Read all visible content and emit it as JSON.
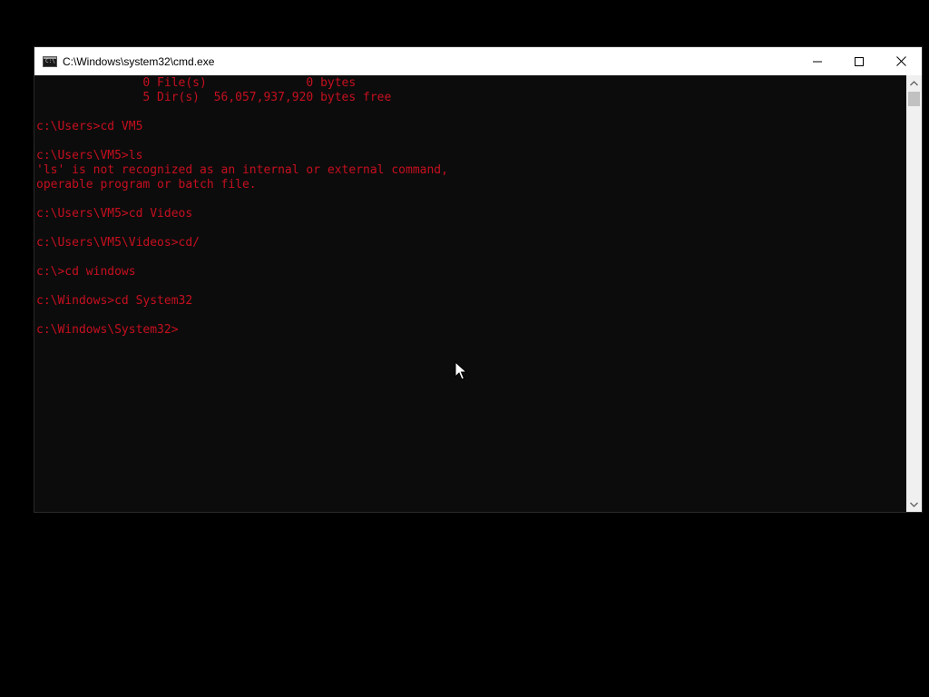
{
  "window": {
    "title": "C:\\Windows\\system32\\cmd.exe",
    "icon": "cmd-icon",
    "icon_text": "C:\\"
  },
  "caption_buttons": {
    "minimize": "minimize-icon",
    "maximize": "maximize-icon",
    "close": "close-icon"
  },
  "console": {
    "text_color": "#c50f1f",
    "background": "#0c0c0c",
    "lines": [
      "               0 File(s)              0 bytes",
      "               5 Dir(s)  56,057,937,920 bytes free",
      "",
      "c:\\Users>cd VM5",
      "",
      "c:\\Users\\VM5>ls",
      "'ls' is not recognized as an internal or external command,",
      "operable program or batch file.",
      "",
      "c:\\Users\\VM5>cd Videos",
      "",
      "c:\\Users\\VM5\\Videos>cd/",
      "",
      "c:\\>cd windows",
      "",
      "c:\\Windows>cd System32",
      "",
      "c:\\Windows\\System32>"
    ]
  },
  "scrollbar": {
    "up_icon": "chevron-up-icon",
    "down_icon": "chevron-down-icon"
  }
}
